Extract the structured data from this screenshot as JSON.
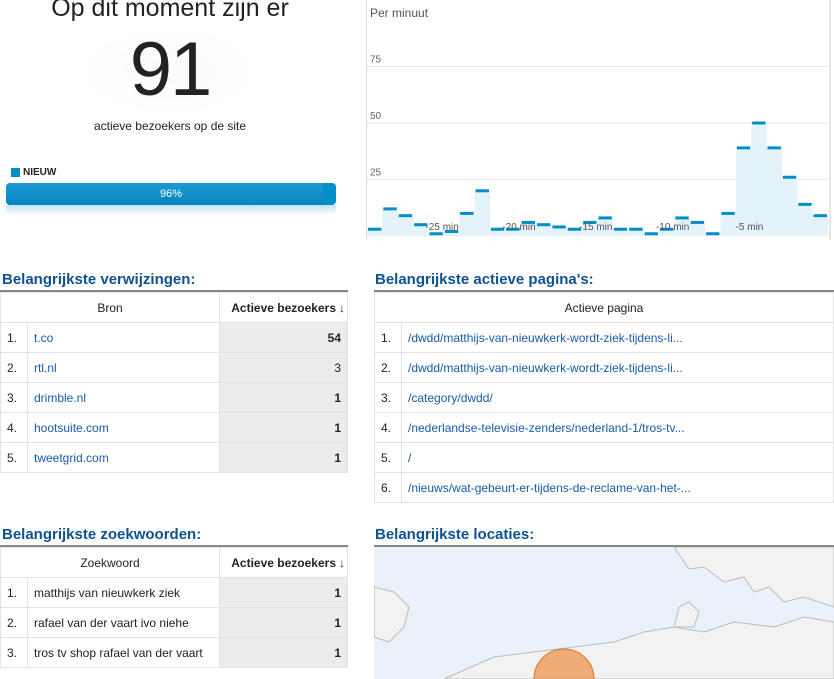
{
  "summary": {
    "heading": "Op dit moment zijn er",
    "count": "91",
    "subtitle": "actieve bezoekers op de site",
    "legend_new": "NIEUW",
    "new_percent_label": "96%",
    "new_fraction": 0.96
  },
  "chart": {
    "title": "Per minuut",
    "ytick_labels": [
      "75",
      "50",
      "25"
    ],
    "xtick_labels": [
      "-25 min",
      "-20 min",
      "-15 min",
      "-10 min",
      "-5 min"
    ],
    "accent": "#058dc7",
    "fill": "#e4f2fa"
  },
  "chart_data": {
    "type": "bar",
    "title": "Per minuut",
    "ylim": [
      0,
      100
    ],
    "yticks": [
      25,
      50,
      75
    ],
    "x": [
      -29,
      -28,
      -27,
      -26,
      -25,
      -24,
      -23,
      -22,
      -21,
      -20,
      -19,
      -18,
      -17,
      -16,
      -15,
      -14,
      -13,
      -12,
      -11,
      -10,
      -9,
      -8,
      -7,
      -6,
      -5,
      -4,
      -3,
      -2,
      -1,
      0
    ],
    "xtick_labels": [
      "-25 min",
      "-20 min",
      "-15 min",
      "-10 min",
      "-5 min"
    ],
    "values": [
      3,
      12,
      9,
      5,
      1,
      2,
      10,
      20,
      3,
      3,
      6,
      5,
      4,
      3,
      6,
      8,
      3,
      3,
      1,
      3,
      8,
      6,
      1,
      10,
      39,
      50,
      39,
      26,
      14,
      9
    ]
  },
  "referrals": {
    "title": "Belangrijkste verwijzingen:",
    "col_source": "Bron",
    "col_metric": "Actieve bezoekers",
    "rows": [
      {
        "idx": "1.",
        "name": "t.co",
        "value": "54"
      },
      {
        "idx": "2.",
        "name": "rtl.nl",
        "value": "3"
      },
      {
        "idx": "3.",
        "name": "drimble.nl",
        "value": "1"
      },
      {
        "idx": "4.",
        "name": "hootsuite.com",
        "value": "1"
      },
      {
        "idx": "5.",
        "name": "tweetgrid.com",
        "value": "1"
      }
    ]
  },
  "pages": {
    "title": "Belangrijkste actieve pagina's:",
    "col_page": "Actieve pagina",
    "rows": [
      {
        "idx": "1.",
        "path": "/dwdd/matthijs-van-nieuwkerk-wordt-ziek-tijdens-li..."
      },
      {
        "idx": "2.",
        "path": "/dwdd/matthijs-van-nieuwkerk-wordt-ziek-tijdens-li..."
      },
      {
        "idx": "3.",
        "path": "/category/dwdd/"
      },
      {
        "idx": "4.",
        "path": "/nederlandse-televisie-zenders/nederland-1/tros-tv..."
      },
      {
        "idx": "5.",
        "path": "/"
      },
      {
        "idx": "6.",
        "path": "/nieuws/wat-gebeurt-er-tijdens-de-reclame-van-het-..."
      }
    ]
  },
  "keywords": {
    "title": "Belangrijkste zoekwoorden:",
    "col_keyword": "Zoekwoord",
    "col_metric": "Actieve bezoekers",
    "rows": [
      {
        "idx": "1.",
        "keyword": "matthijs van nieuwkerk ziek",
        "value": "1"
      },
      {
        "idx": "2.",
        "keyword": "rafael van der vaart ivo niehe",
        "value": "1"
      },
      {
        "idx": "3.",
        "keyword": "tros tv shop rafael van der vaart",
        "value": "1"
      }
    ]
  },
  "locations": {
    "title": "Belangrijkste locaties:",
    "sea_color": "#e9f1fa",
    "land_color": "#f2f2f2",
    "marker_color": "#f0a060"
  }
}
